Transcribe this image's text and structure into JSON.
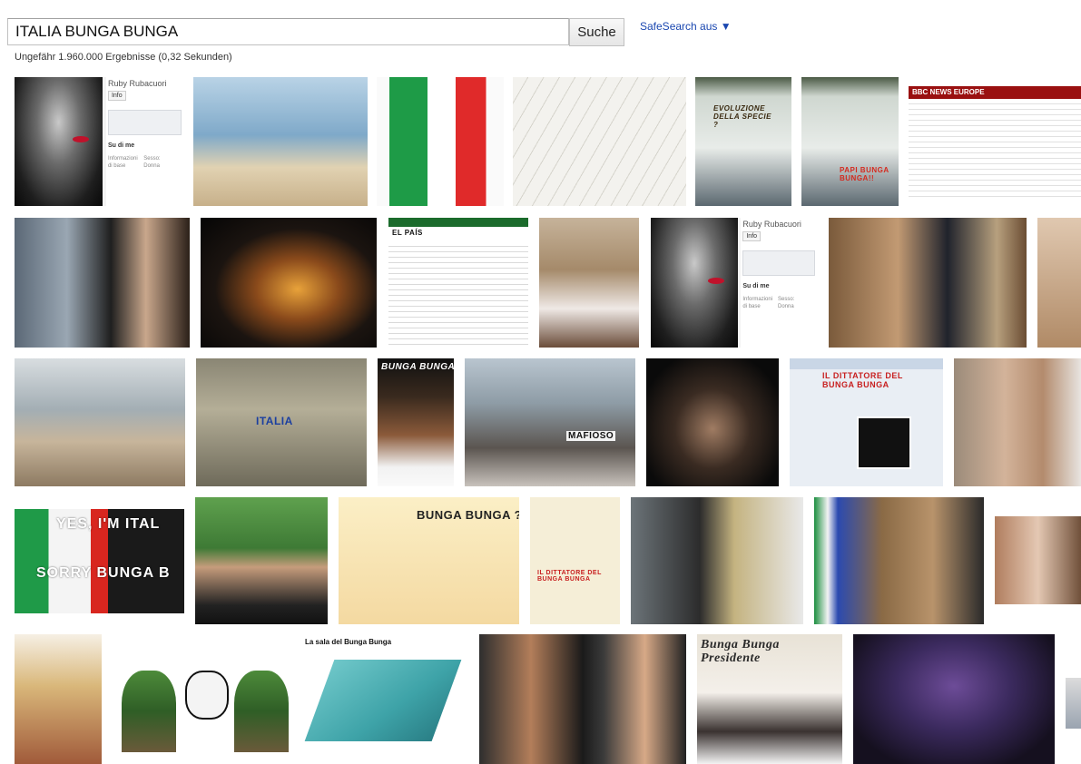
{
  "search": {
    "query": "ITALIA BUNGA BUNGA",
    "button_label": "Suche",
    "safesearch_label": "SafeSearch aus ▼",
    "result_stats": "Ungefähr 1.960.000 Ergebnisse (0,32 Sekunden)"
  },
  "profile_card": {
    "name": "Ruby Rubacuori",
    "tab": "Info",
    "section": "Su di me",
    "info_label": "Informazioni di base",
    "sex_label": "Sesso:",
    "sex_value": "Donna"
  },
  "thumbnail_captions": {
    "evoluzione": "EVOLUZIONE DELLA SPECIE ?",
    "bbc": "BBC NEWS EUROPE",
    "italia_shirt": "ITALIA",
    "bunga_poster": "BUNGA BUNGA",
    "mafioso": "MAFIOSO",
    "dittatore": "IL DITTATORE DEL BUNGA BUNGA",
    "yes_italia": "YES, I'M ITAL",
    "sorry_bunga": "SORRY BUNGA B",
    "cartoon_bunga": "BUNGA BUNGA ?",
    "sala": "La sala del Bunga Bunga",
    "presidente": "Bunga Bunga Presidente",
    "papi": "PAPI BUNGA BUNGA!!",
    "corriere": "EL PAÍS"
  }
}
